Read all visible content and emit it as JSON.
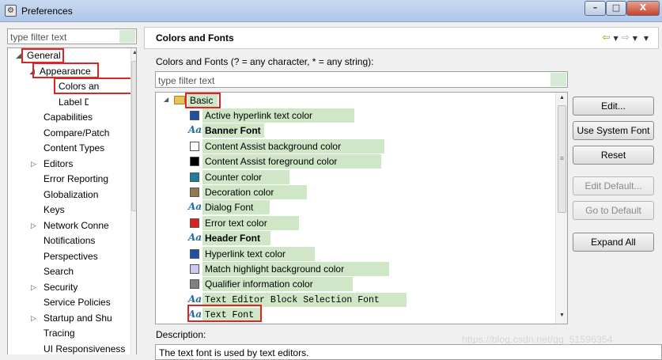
{
  "window": {
    "title": "Preferences",
    "min_label": "–",
    "max_label": "□",
    "close_label": "X"
  },
  "left": {
    "filter_placeholder": "type filter text",
    "tree": [
      {
        "label": "General",
        "twist": "◢"
      },
      {
        "label": "Appearance",
        "twist": "◢"
      },
      {
        "label": "Colors and Fonts"
      },
      {
        "label": "Label Decorations"
      },
      {
        "label": "Capabilities"
      },
      {
        "label": "Compare/Patch"
      },
      {
        "label": "Content Types"
      },
      {
        "label": "Editors",
        "twist": "▷"
      },
      {
        "label": "Error Reporting"
      },
      {
        "label": "Globalization"
      },
      {
        "label": "Keys"
      },
      {
        "label": "Network Connections",
        "twist": "▷"
      },
      {
        "label": "Notifications"
      },
      {
        "label": "Perspectives"
      },
      {
        "label": "Search"
      },
      {
        "label": "Security",
        "twist": "▷"
      },
      {
        "label": "Service Policies"
      },
      {
        "label": "Startup and Shutdown",
        "twist": "▷"
      },
      {
        "label": "Tracing"
      },
      {
        "label": "UI Responsiveness"
      }
    ]
  },
  "right": {
    "header_title": "Colors and Fonts",
    "pattern_hint": "Colors and Fonts (? = any character, * = any string):",
    "filter_placeholder": "type filter text",
    "category": {
      "label": "Basic",
      "twist": "◢"
    },
    "items": [
      {
        "label": "Active hyperlink text color",
        "kind": "color",
        "color": "#1f4fa8"
      },
      {
        "label": "Banner Font",
        "kind": "font",
        "style": "bold"
      },
      {
        "label": "Content Assist background color",
        "kind": "color",
        "color": "#ffffff"
      },
      {
        "label": "Content Assist foreground color",
        "kind": "color",
        "color": "#000000"
      },
      {
        "label": "Counter color",
        "kind": "color",
        "color": "#1e7fa0"
      },
      {
        "label": "Decoration color",
        "kind": "color",
        "color": "#94784e"
      },
      {
        "label": "Dialog Font",
        "kind": "font",
        "style": "normal"
      },
      {
        "label": "Error text color",
        "kind": "color",
        "color": "#e01f1f"
      },
      {
        "label": "Header Font",
        "kind": "font",
        "style": "bold"
      },
      {
        "label": "Hyperlink text color",
        "kind": "color",
        "color": "#1f4fa8"
      },
      {
        "label": "Match highlight background color",
        "kind": "color",
        "color": "#cdc8f0"
      },
      {
        "label": "Qualifier information color",
        "kind": "color",
        "color": "#808080"
      },
      {
        "label": "Text Editor Block Selection Font",
        "kind": "font",
        "style": "mono"
      },
      {
        "label": "Text Font",
        "kind": "font",
        "style": "mono"
      }
    ],
    "buttons": {
      "edit": "Edit...",
      "use_system_font": "Use System Font",
      "reset": "Reset",
      "edit_default": "Edit Default...",
      "go_to_default": "Go to Default",
      "expand_all": "Expand All"
    },
    "description_label": "Description:",
    "description_text": "The text font is used by text editors."
  },
  "watermark": "https://blog.csdn.net/qq_51596354",
  "icons": {
    "font": "Aa",
    "back_arrow": "⇦",
    "forward_arrow": "⇨",
    "dropdown": "▼",
    "folder": "folder-icon"
  }
}
